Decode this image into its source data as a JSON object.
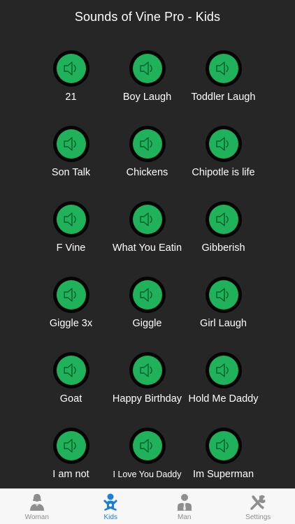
{
  "header": {
    "title": "Sounds of Vine Pro - Kids"
  },
  "sounds": [
    {
      "label": "21"
    },
    {
      "label": "Boy Laugh"
    },
    {
      "label": "Toddler Laugh"
    },
    {
      "label": "Son Talk"
    },
    {
      "label": "Chickens"
    },
    {
      "label": "Chipotle is life"
    },
    {
      "label": "F Vine"
    },
    {
      "label": "What You Eatin"
    },
    {
      "label": "Gibberish"
    },
    {
      "label": "Giggle 3x"
    },
    {
      "label": "Giggle"
    },
    {
      "label": "Girl Laugh"
    },
    {
      "label": "Goat"
    },
    {
      "label": "Happy Birthday"
    },
    {
      "label": "Hold Me Daddy"
    },
    {
      "label": "I am not"
    },
    {
      "label": "I Love You Daddy"
    },
    {
      "label": "Im Superman"
    }
  ],
  "tabbar": {
    "tabs": [
      {
        "label": "Woman",
        "icon": "woman-icon",
        "active": false
      },
      {
        "label": "Kids",
        "icon": "baby-icon",
        "active": true
      },
      {
        "label": "Man",
        "icon": "man-icon",
        "active": false
      },
      {
        "label": "Settings",
        "icon": "tools-icon",
        "active": false
      }
    ]
  },
  "colors": {
    "background": "#262626",
    "button_green": "#1fb25a",
    "button_ring": "#050505",
    "active_tab": "#1b7fd9",
    "inactive_tab": "#8e8e8e"
  }
}
